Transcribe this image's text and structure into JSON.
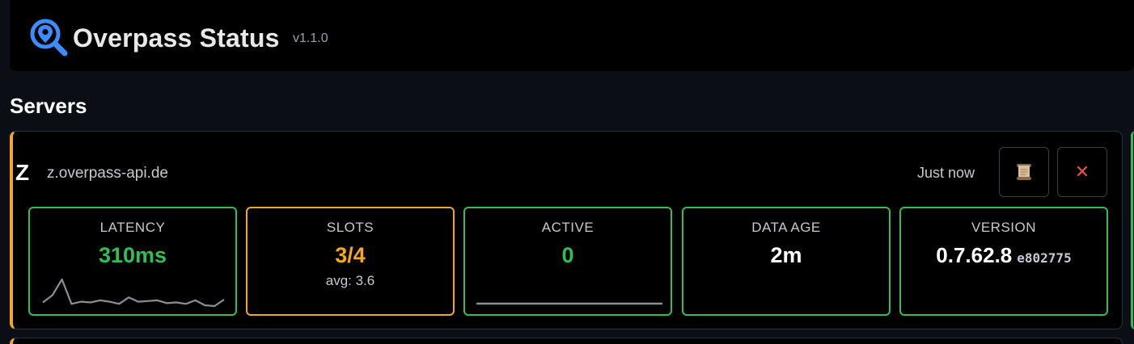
{
  "app": {
    "title": "Overpass Status",
    "version": "v1.1.0",
    "logo_icon": "map-search-icon"
  },
  "section": {
    "title": "Servers"
  },
  "server": {
    "letter": "Z",
    "host": "z.overpass-api.de",
    "updated": "Just now",
    "log_icon": "scroll-icon",
    "remove_icon": "close-icon",
    "remove_glyph": "✕",
    "status_color": "#f5a623"
  },
  "stats": {
    "latency": {
      "label": "LATENCY",
      "value": "310ms",
      "history_ms": [
        310,
        360,
        470,
        300,
        315,
        310,
        325,
        315,
        300,
        345,
        315,
        320,
        325,
        305,
        310,
        300,
        325,
        290,
        285,
        330
      ]
    },
    "slots": {
      "label": "SLOTS",
      "value": "3/4",
      "avg": "avg: 3.6"
    },
    "active": {
      "label": "ACTIVE",
      "value": "0"
    },
    "data_age": {
      "label": "DATA AGE",
      "value": "2m"
    },
    "version": {
      "label": "VERSION",
      "value": "0.7.62.8",
      "hash": "e802775"
    }
  },
  "colors": {
    "ok": "#2fbf55",
    "warn": "#f5a623",
    "danger": "#e5534b",
    "accent": "#3d8bfd"
  }
}
